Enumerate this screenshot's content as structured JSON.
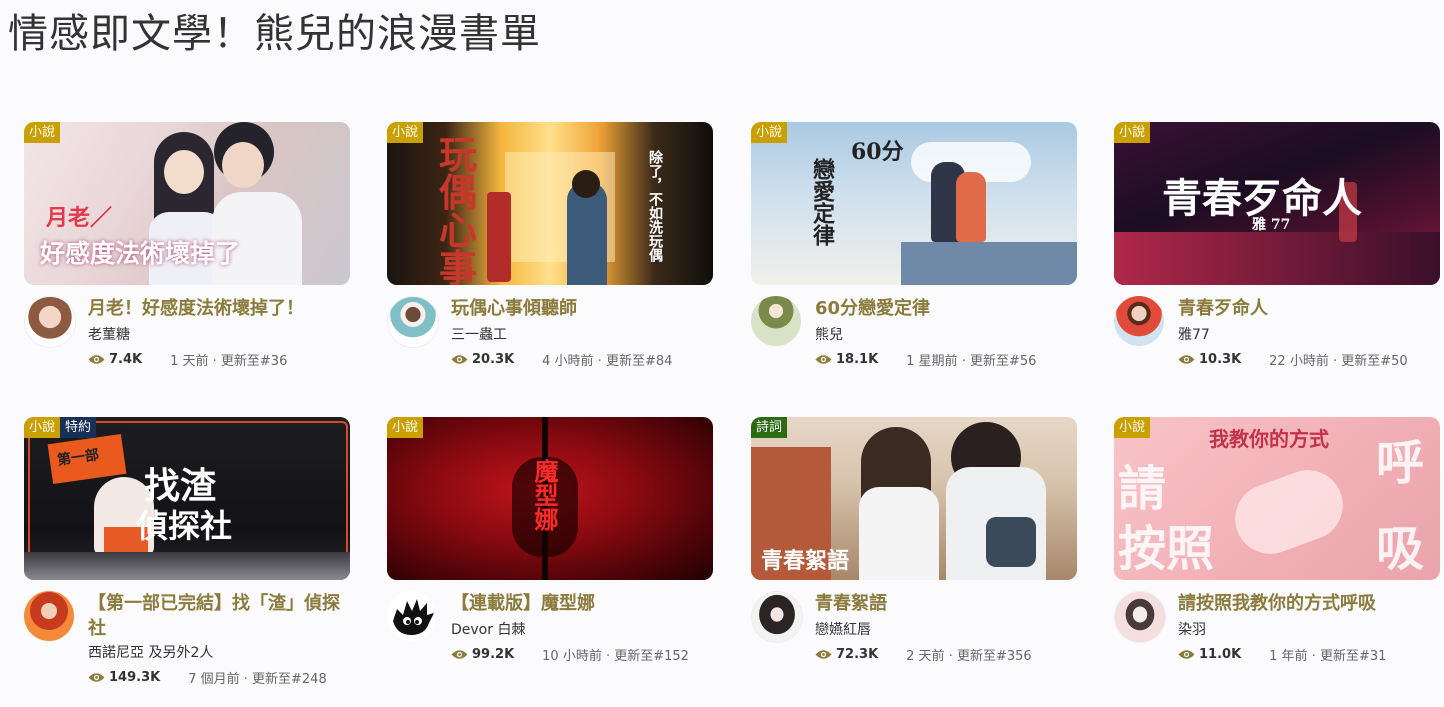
{
  "page_title": "情感即文學！熊兒的浪漫書單",
  "cards": [
    {
      "tags": [
        {
          "label": "小說",
          "kind": "novel"
        }
      ],
      "cover_text": "月老／好感度法術壞掉了",
      "title": "月老！好感度法術壞掉了！",
      "author": "老菫糖",
      "views": "7.4K",
      "meta": "1 天前 · 更新至#36"
    },
    {
      "tags": [
        {
          "label": "小說",
          "kind": "novel"
        }
      ],
      "cover_text": "玩偶心事",
      "title": "玩偶心事傾聽師",
      "author": "三一蟲工",
      "views": "20.3K",
      "meta": "4 小時前 · 更新至#84"
    },
    {
      "tags": [
        {
          "label": "小說",
          "kind": "novel"
        }
      ],
      "cover_text": "60分 戀愛定律",
      "title": "60分戀愛定律",
      "author": "熊兒",
      "views": "18.1K",
      "meta": "1 星期前 · 更新至#56"
    },
    {
      "tags": [
        {
          "label": "小說",
          "kind": "novel"
        }
      ],
      "cover_text": "青春歹命人",
      "title": "青春歹命人",
      "author": "雅77",
      "views": "10.3K",
      "meta": "22 小時前 · 更新至#50"
    },
    {
      "tags": [
        {
          "label": "小說",
          "kind": "novel"
        },
        {
          "label": "特約",
          "kind": "signed"
        }
      ],
      "cover_text": "找渣偵探社",
      "title": "【第一部已完結】找「渣」偵探社",
      "author": "西諾尼亞 及另外2人",
      "views": "149.3K",
      "meta": "7 個月前 · 更新至#248"
    },
    {
      "tags": [
        {
          "label": "小說",
          "kind": "novel"
        }
      ],
      "cover_text": "魔型娜",
      "title": "【連載版】魔型娜",
      "author": "Devor 白棘",
      "views": "99.2K",
      "meta": "10 小時前 · 更新至#152"
    },
    {
      "tags": [
        {
          "label": "詩詞",
          "kind": "poem"
        }
      ],
      "cover_text": "青春絮語",
      "title": "青春絮語",
      "author": "戀嬿紅唇",
      "views": "72.3K",
      "meta": "2 天前 · 更新至#356"
    },
    {
      "tags": [
        {
          "label": "小說",
          "kind": "novel"
        }
      ],
      "cover_text": "請按照我教你的方式呼吸",
      "title": "請按照我教你的方式呼吸",
      "author": "染羽",
      "views": "11.0K",
      "meta": "1 年前 · 更新至#31"
    }
  ]
}
